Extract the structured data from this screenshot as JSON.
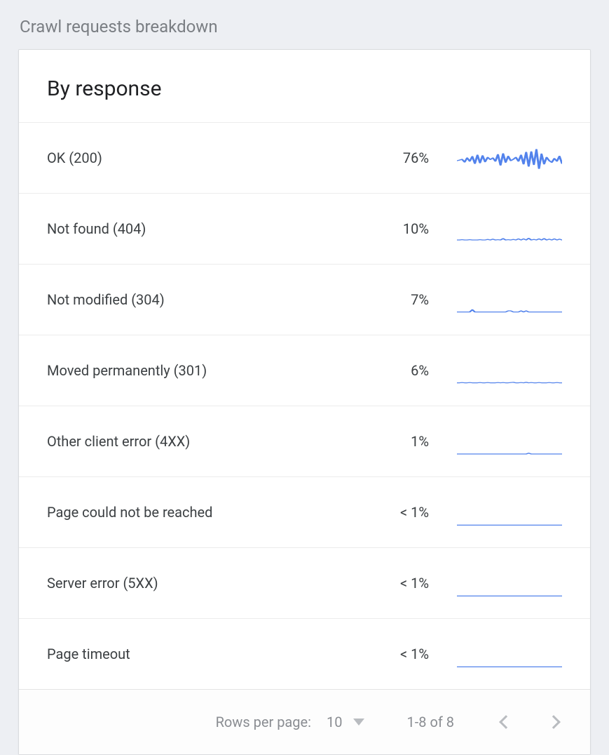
{
  "page_title": "Crawl requests breakdown",
  "card": {
    "title": "By response",
    "rows": [
      {
        "label": "OK (200)",
        "value": "76%",
        "spark": [
          60,
          58,
          55,
          65,
          50,
          62,
          45,
          70,
          40,
          68,
          42,
          64,
          48,
          56,
          50,
          62,
          38,
          76,
          35,
          66,
          44,
          60,
          55,
          48,
          62,
          40,
          72,
          30,
          80,
          28,
          74,
          20,
          88,
          36,
          72,
          48,
          60,
          66,
          52,
          62,
          44,
          70
        ]
      },
      {
        "label": "Not found (404)",
        "value": "10%",
        "spark": [
          90,
          90,
          89,
          90,
          90,
          89,
          90,
          90,
          90,
          89,
          90,
          90,
          88,
          90,
          87,
          90,
          89,
          90,
          85,
          90,
          89,
          90,
          88,
          90,
          86,
          90,
          86,
          90,
          84,
          90,
          88,
          90,
          86,
          90,
          85,
          90,
          87,
          90,
          86,
          90,
          87,
          90
        ]
      },
      {
        "label": "Not modified (304)",
        "value": "7%",
        "spark": [
          94,
          94,
          94,
          94,
          94,
          94,
          86,
          94,
          94,
          94,
          94,
          94,
          94,
          94,
          94,
          94,
          94,
          94,
          94,
          94,
          90,
          90,
          94,
          94,
          94,
          90,
          94,
          90,
          94,
          94,
          94,
          94,
          94,
          94,
          94,
          94,
          94,
          94,
          94,
          94,
          94,
          94
        ]
      },
      {
        "label": "Moved permanently (301)",
        "value": "6%",
        "spark": [
          94,
          94,
          93,
          94,
          94,
          93,
          94,
          94,
          94,
          93,
          94,
          94,
          93,
          94,
          94,
          94,
          93,
          94,
          93,
          94,
          94,
          93,
          92,
          94,
          94,
          93,
          94,
          92,
          94,
          93,
          94,
          94,
          93,
          94,
          94,
          94,
          93,
          94,
          94,
          93,
          94,
          94
        ]
      },
      {
        "label": "Other client error (4XX)",
        "value": "1%",
        "spark": [
          95,
          95,
          95,
          95,
          95,
          95,
          95,
          95,
          95,
          95,
          95,
          95,
          95,
          95,
          95,
          95,
          95,
          95,
          95,
          95,
          95,
          95,
          95,
          95,
          95,
          95,
          95,
          95,
          92,
          95,
          95,
          95,
          95,
          95,
          95,
          95,
          95,
          95,
          95,
          95,
          95,
          95
        ]
      },
      {
        "label": "Page could not be reached",
        "value": "< 1%",
        "spark": [
          96,
          96,
          96,
          96,
          96,
          96,
          96,
          96,
          96,
          96,
          96,
          96,
          96,
          96,
          96,
          96,
          96,
          96,
          96,
          96,
          96,
          96,
          96,
          96,
          96,
          96,
          96,
          96,
          96,
          96,
          96,
          96,
          96,
          96,
          96,
          96,
          96,
          96,
          96,
          96,
          96,
          96
        ]
      },
      {
        "label": "Server error (5XX)",
        "value": "< 1%",
        "spark": [
          96,
          96,
          96,
          96,
          96,
          96,
          96,
          96,
          96,
          96,
          96,
          96,
          96,
          96,
          96,
          96,
          96,
          96,
          96,
          96,
          96,
          96,
          96,
          96,
          96,
          96,
          96,
          96,
          96,
          96,
          96,
          96,
          96,
          96,
          96,
          96,
          96,
          96,
          96,
          96,
          96,
          96
        ]
      },
      {
        "label": "Page timeout",
        "value": "< 1%",
        "spark": [
          96,
          96,
          96,
          96,
          96,
          96,
          96,
          96,
          96,
          96,
          96,
          96,
          96,
          96,
          96,
          96,
          96,
          96,
          96,
          96,
          96,
          96,
          96,
          96,
          96,
          96,
          96,
          96,
          96,
          96,
          96,
          96,
          96,
          96,
          96,
          96,
          96,
          96,
          96,
          96,
          96,
          96
        ]
      }
    ],
    "footer": {
      "rows_per_page_label": "Rows per page:",
      "rows_per_page_value": "10",
      "range_text": "1-8 of 8"
    }
  }
}
